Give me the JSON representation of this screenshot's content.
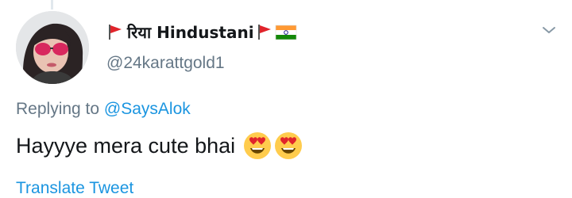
{
  "tweet": {
    "display_name": "रिया Hindustani",
    "handle": "@24karattgold1",
    "replying_prefix": "Replying to",
    "replying_to": "@SaysAlok",
    "text": "Hayyye mera cute bhai",
    "emojis": [
      "heart-eyes-emoji",
      "heart-eyes-emoji"
    ],
    "translate_label": "Translate Tweet"
  },
  "icons": {
    "name_prefix": "red-flag-icon",
    "name_suffix_1": "red-flag-icon",
    "name_suffix_2": "india-flag-icon",
    "menu": "chevron-down-icon"
  },
  "colors": {
    "text_primary": "#14171a",
    "text_secondary": "#657786",
    "link": "#1b95e0",
    "flag_red": "#e0242b"
  }
}
